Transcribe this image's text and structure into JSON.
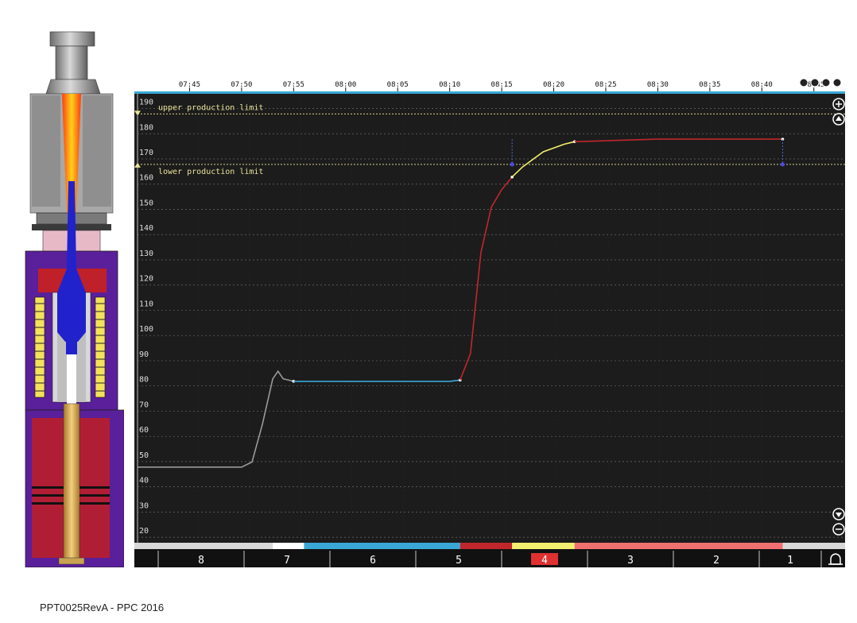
{
  "footer": {
    "note": "PPT0025RevA - PPC 2016"
  },
  "colors": {
    "background": "#1c1c1c",
    "grid": "#6a6a6a",
    "limit_line": "#d6d08a",
    "segment_gray": "#9a9a9a",
    "segment_blue": "#3aa8d6",
    "segment_red": "#c0272d",
    "segment_yellow": "#f2ef6e",
    "segment_salmon": "#f07070",
    "active_tab": "#e03030",
    "timeline_blue": "#3aa8d6"
  },
  "limits": {
    "upper_label": "upper production limit",
    "upper_value": 185,
    "lower_label": "lower production limit",
    "lower_value": 165
  },
  "tabs": [
    {
      "label": "8",
      "active": false
    },
    {
      "label": "7",
      "active": false
    },
    {
      "label": "6",
      "active": false
    },
    {
      "label": "5",
      "active": false
    },
    {
      "label": "4",
      "active": true
    },
    {
      "label": "3",
      "active": false
    },
    {
      "label": "2",
      "active": false
    },
    {
      "label": "1",
      "active": false
    }
  ],
  "icons": {
    "zoom_in": "zoom-in-icon",
    "scroll_up": "scroll-up-icon",
    "scroll_down": "scroll-down-icon",
    "zoom_out": "zoom-out-icon",
    "alarm": "bell-icon",
    "window_controls": "window-controls-icon"
  },
  "chart_data": {
    "type": "line",
    "x_ticks": [
      "07:45",
      "07:50",
      "07:55",
      "08:00",
      "08:05",
      "08:10",
      "08:15",
      "08:20",
      "08:25",
      "08:30",
      "08:35",
      "08:40",
      "08:45"
    ],
    "y_ticks": [
      190,
      180,
      170,
      160,
      150,
      140,
      130,
      120,
      110,
      100,
      90,
      80,
      70,
      60,
      50,
      40,
      30,
      20
    ],
    "xlim": [
      "07:40",
      "08:48"
    ],
    "ylim": [
      15,
      193
    ],
    "grid": true,
    "series": [
      {
        "color": "#9a9a9a",
        "points": [
          [
            "07:40",
            45
          ],
          [
            "07:50",
            45
          ],
          [
            "07:51",
            47
          ],
          [
            "07:52",
            62
          ],
          [
            "07:53",
            80
          ],
          [
            "07:53.5",
            83
          ],
          [
            "07:54",
            80
          ],
          [
            "07:55",
            79
          ]
        ]
      },
      {
        "color": "#3aa8d6",
        "points": [
          [
            "07:55",
            79
          ],
          [
            "08:00",
            79
          ],
          [
            "08:05",
            79
          ],
          [
            "08:10",
            79
          ],
          [
            "08:11",
            79.5
          ]
        ]
      },
      {
        "color": "#c0272d",
        "points": [
          [
            "08:11",
            79.5
          ],
          [
            "08:12",
            90
          ],
          [
            "08:13",
            130
          ],
          [
            "08:14",
            148
          ],
          [
            "08:15",
            155
          ],
          [
            "08:16",
            160
          ]
        ]
      },
      {
        "color": "#f2ef6e",
        "points": [
          [
            "08:16",
            160
          ],
          [
            "08:17",
            164
          ],
          [
            "08:19",
            170
          ],
          [
            "08:21",
            173
          ],
          [
            "08:22",
            174
          ]
        ]
      },
      {
        "color": "#c0272d",
        "points": [
          [
            "08:22",
            174
          ],
          [
            "08:30",
            175
          ],
          [
            "08:40",
            175
          ],
          [
            "08:42",
            175
          ]
        ]
      }
    ],
    "timeline_bar": [
      {
        "from": "07:40",
        "to": "07:53",
        "color": "#d8d8d8"
      },
      {
        "from": "07:53",
        "to": "07:56",
        "color": "#ffffff"
      },
      {
        "from": "07:56",
        "to": "08:11",
        "color": "#3aa8d6"
      },
      {
        "from": "08:11",
        "to": "08:16",
        "color": "#c0272d"
      },
      {
        "from": "08:16",
        "to": "08:22",
        "color": "#f2ef6e"
      },
      {
        "from": "08:22",
        "to": "08:42",
        "color": "#f07070"
      }
    ]
  }
}
